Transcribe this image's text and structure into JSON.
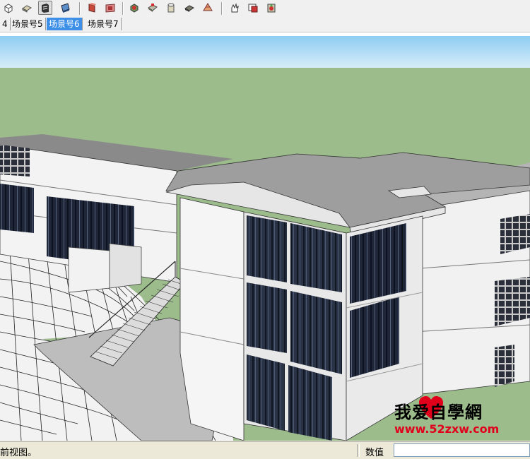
{
  "toolbar": {
    "icons": [
      "view-iso-icon",
      "view-top-icon",
      "view-front-icon",
      "view-right-icon",
      "section-plane-icon",
      "section-display-icon",
      "intersect-icon",
      "union-icon",
      "subtract-icon",
      "trim-icon",
      "split-icon",
      "sandbox-icon",
      "hand-icon",
      "photo-texture-icon",
      "plugin-icon"
    ]
  },
  "scene_tabs": [
    {
      "label": "4",
      "active": false
    },
    {
      "label": "场景号5",
      "active": false
    },
    {
      "label": "场景号6",
      "active": true
    },
    {
      "label": "场景号7",
      "active": false
    }
  ],
  "status": {
    "message": "前视图。",
    "vcb_label": "数值",
    "vcb_value": ""
  },
  "watermark": {
    "title": "我爱自學網",
    "url": "www.52zxw.com"
  },
  "colors": {
    "sky": "#b6dcf3",
    "ground": "#9cbc8c",
    "wall": "#f2f2f2",
    "roof": "#a8a8a8",
    "glass": "#2a3246",
    "active_tab": "#3d8fe8",
    "watermark_red": "#e0001b"
  }
}
